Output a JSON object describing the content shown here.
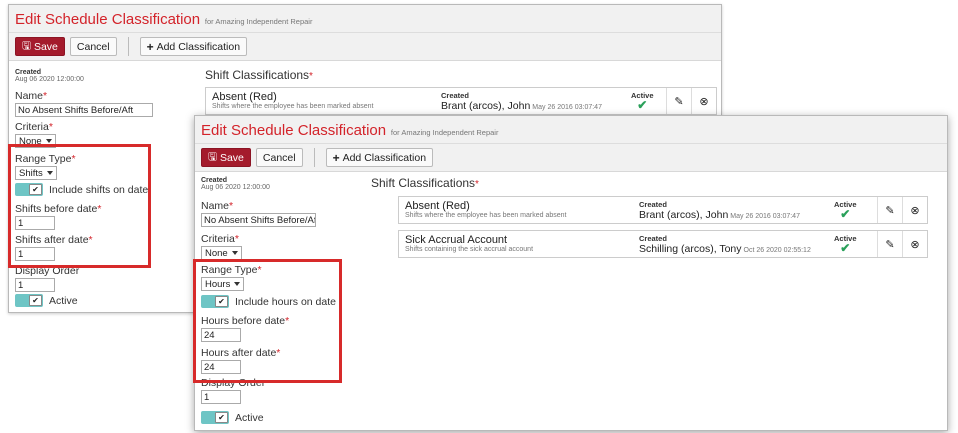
{
  "back": {
    "title": "Edit Schedule Classification",
    "title_for": "for Amazing Independent Repair",
    "toolbar": {
      "save": "Save",
      "cancel": "Cancel",
      "add": "Add Classification"
    },
    "created_label": "Created",
    "created_value": "Aug 06 2020 12:00:00",
    "name_label": "Name",
    "name_value": "No Absent Shifts Before/Aft",
    "criteria_label": "Criteria",
    "criteria_value": "None",
    "range_type_label": "Range Type",
    "range_type_value": "Shifts",
    "include_label": "Include shifts on date",
    "before_label": "Shifts before date",
    "before_value": "1",
    "after_label": "Shifts after date",
    "after_value": "1",
    "display_order_label": "Display Order",
    "display_order_value": "1",
    "active_label": "Active",
    "classifications_title": "Shift Classifications",
    "classifications": [
      {
        "name": "Absent (Red)",
        "desc": "Shifts where the employee has been marked absent",
        "created_label": "Created",
        "created_by": "Brant (arcos), John",
        "created_on": "May 26 2016 03:07:47",
        "active_label": "Active"
      }
    ]
  },
  "front": {
    "title": "Edit Schedule Classification",
    "title_for": "for Amazing Independent Repair",
    "toolbar": {
      "save": "Save",
      "cancel": "Cancel",
      "add": "Add Classification"
    },
    "created_label": "Created",
    "created_value": "Aug 06 2020 12:00:00",
    "name_label": "Name",
    "name_value": "No Absent Shifts Before/Aft",
    "criteria_label": "Criteria",
    "criteria_value": "None",
    "range_type_label": "Range Type",
    "range_type_value": "Hours",
    "include_label": "Include hours on date",
    "before_label": "Hours before date",
    "before_value": "24",
    "after_label": "Hours after date",
    "after_value": "24",
    "display_order_label": "Display Order",
    "display_order_value": "1",
    "active_label": "Active",
    "classifications_title": "Shift Classifications",
    "classifications": [
      {
        "name": "Absent (Red)",
        "desc": "Shifts where the employee has been marked absent",
        "created_label": "Created",
        "created_by": "Brant (arcos), John",
        "created_on": "May 26 2016 03:07:47",
        "active_label": "Active"
      },
      {
        "name": "Sick Accrual Account",
        "desc": "Shifts containing the sick accrual account",
        "created_label": "Created",
        "created_by": "Schilling (arcos), Tony",
        "created_on": "Oct 26 2020 02:55:12",
        "active_label": "Active"
      }
    ]
  },
  "required_mark": "*",
  "colors": {
    "title_red": "#d3232a",
    "save_bg": "#a41b2c",
    "toggle_teal": "#6ec5c5",
    "highlight_red": "#d72a2a",
    "check_green": "#2aa05a"
  }
}
